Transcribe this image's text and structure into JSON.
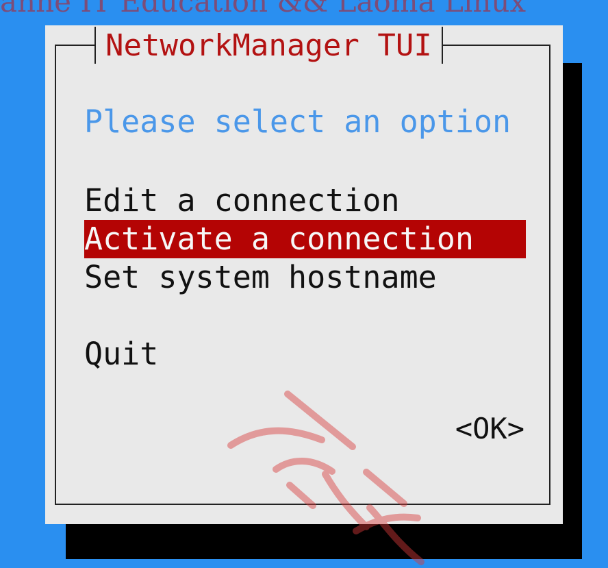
{
  "watermark": {
    "top_text": "anhe IT Education && Laoma Linux",
    "seal_text": "万和"
  },
  "dialog": {
    "title": "NetworkManager TUI",
    "prompt": "Please select an option",
    "menu_items": [
      {
        "label": "Edit a connection",
        "selected": false
      },
      {
        "label": "Activate a connection",
        "selected": true
      },
      {
        "label": "Set system hostname",
        "selected": false
      },
      {
        "label": "Quit",
        "selected": false
      }
    ],
    "ok_button": "<OK>"
  },
  "colors": {
    "background": "#2a8ff0",
    "dialog": "#e9e9e9",
    "title": "#b31212",
    "prompt": "#4a97e9",
    "selection": "#b40404",
    "shadow": "#000000"
  }
}
